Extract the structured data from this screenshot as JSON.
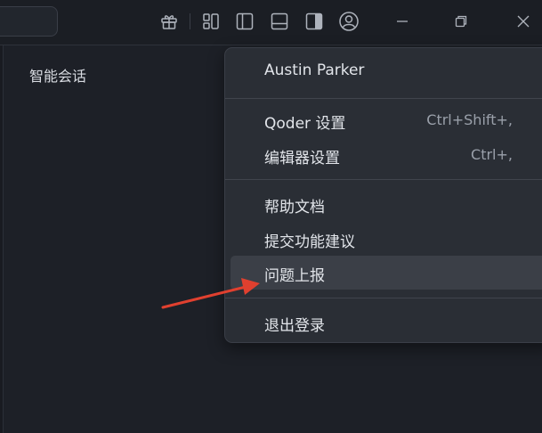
{
  "panel": {
    "title": "智能会话"
  },
  "titlebar": {
    "icons": [
      "gift-icon",
      "layout-grid-icon",
      "toggle-sidebar-icon",
      "toggle-panel-icon",
      "toggle-secondary-sidebar-icon",
      "account-icon",
      "minimize-icon",
      "restore-icon",
      "close-icon"
    ]
  },
  "menu": {
    "user": "Austin Parker",
    "qoder_settings": {
      "label": "Qoder 设置",
      "shortcut": "Ctrl+Shift+,"
    },
    "editor_settings": {
      "label": "编辑器设置",
      "shortcut": "Ctrl+,"
    },
    "help_docs": {
      "label": "帮助文档"
    },
    "feature_request": {
      "label": "提交功能建议"
    },
    "report_issue": {
      "label": "问题上报"
    },
    "logout": {
      "label": "退出登录"
    }
  },
  "colors": {
    "accent_arrow": "#e0402f",
    "menu_bg": "#2a2e35",
    "hover_bg": "#3b3f47"
  }
}
